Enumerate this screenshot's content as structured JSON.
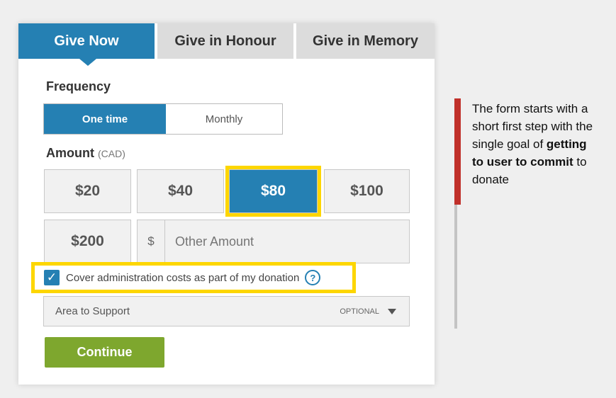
{
  "tabs": [
    {
      "label": "Give Now",
      "active": true
    },
    {
      "label": "Give in Honour",
      "active": false
    },
    {
      "label": "Give in Memory",
      "active": false
    }
  ],
  "frequency": {
    "label": "Frequency",
    "options": [
      "One time",
      "Monthly"
    ],
    "selected": "One time"
  },
  "amount": {
    "label": "Amount",
    "currency": "(CAD)",
    "options": [
      "$20",
      "$40",
      "$80",
      "$100",
      "$200"
    ],
    "selected": "$80",
    "other_symbol": "$",
    "other_placeholder": "Other Amount"
  },
  "cover_costs": {
    "label": "Cover administration costs as part of my donation",
    "checked": true,
    "help": "?"
  },
  "area": {
    "label": "Area to Support",
    "optional": "OPTIONAL"
  },
  "continue_label": "Continue",
  "note": {
    "pre": "The form starts with a short first step with the single goal of ",
    "bold": "getting to user to commit",
    "post": " to donate"
  },
  "colors": {
    "accent": "#2580b3",
    "highlight": "#fdd600",
    "continue": "#7ea72e",
    "note_bar": "#c0302a"
  }
}
